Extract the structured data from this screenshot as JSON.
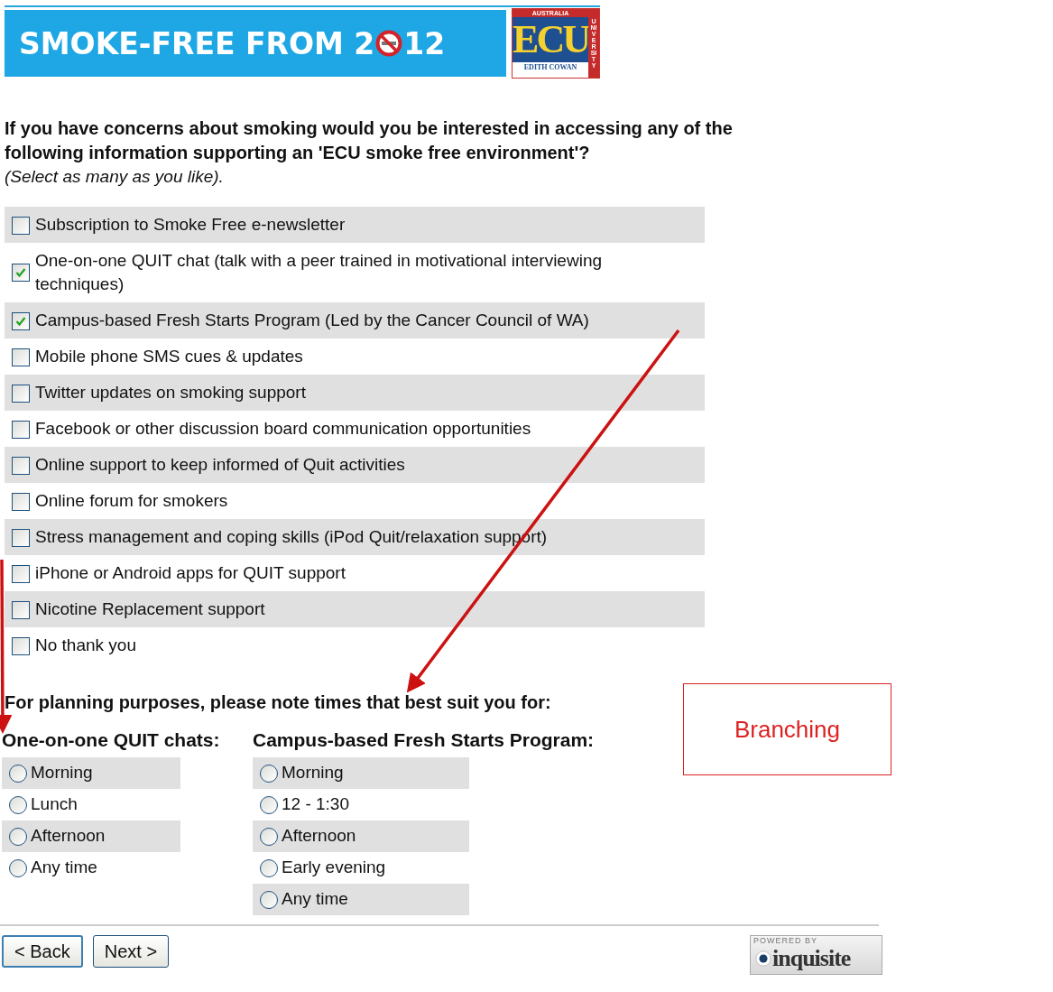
{
  "banner": {
    "title_start": "SMOKE-FREE FROM 2",
    "title_end": "12",
    "logo": {
      "top": "AUSTRALIA",
      "letters": "ECU",
      "bottom": "EDITH COWAN",
      "side": "UNIVERSITY"
    }
  },
  "question": {
    "text": "If you have concerns about smoking would you be interested in accessing any of the following information supporting an 'ECU smoke free environment'?",
    "hint": "(Select as many as you like)."
  },
  "options": [
    {
      "label": "Subscription to Smoke Free e-newsletter",
      "checked": false
    },
    {
      "label": "One-on-one QUIT chat (talk with a peer trained in motivational interviewing techniques)",
      "checked": true
    },
    {
      "label": "Campus-based Fresh Starts Program (Led by the Cancer Council of WA)",
      "checked": true
    },
    {
      "label": "Mobile phone SMS cues & updates",
      "checked": false
    },
    {
      "label": "Twitter updates on smoking support",
      "checked": false
    },
    {
      "label": "Facebook or other discussion board communication opportunities",
      "checked": false
    },
    {
      "label": "Online support to keep informed of Quit activities",
      "checked": false
    },
    {
      "label": "Online forum for smokers",
      "checked": false
    },
    {
      "label": "Stress management and coping skills (iPod Quit/relaxation support)",
      "checked": false
    },
    {
      "label": "iPhone or Android apps for QUIT support",
      "checked": false
    },
    {
      "label": "Nicotine Replacement support",
      "checked": false
    },
    {
      "label": "No thank you",
      "checked": false
    }
  ],
  "planning": {
    "text": "For planning purposes, please note times that best suit you for:",
    "groups": [
      {
        "heading": "One-on-one QUIT chats:",
        "options": [
          {
            "label": "Morning",
            "selected": false
          },
          {
            "label": "Lunch",
            "selected": false
          },
          {
            "label": "Afternoon",
            "selected": false
          },
          {
            "label": "Any time",
            "selected": false
          }
        ]
      },
      {
        "heading": "Campus-based Fresh Starts Program:",
        "options": [
          {
            "label": "Morning",
            "selected": false
          },
          {
            "label": "12 - 1:30",
            "selected": false
          },
          {
            "label": "Afternoon",
            "selected": false
          },
          {
            "label": "Early evening",
            "selected": false
          },
          {
            "label": "Any time",
            "selected": false
          }
        ]
      }
    ]
  },
  "annotation": {
    "text": "Branching"
  },
  "buttons": [
    {
      "label": "< Back",
      "focused": true
    },
    {
      "label": "Next >",
      "focused": false
    }
  ],
  "badge": {
    "top": "POWERED BY",
    "name": "inquisite"
  }
}
